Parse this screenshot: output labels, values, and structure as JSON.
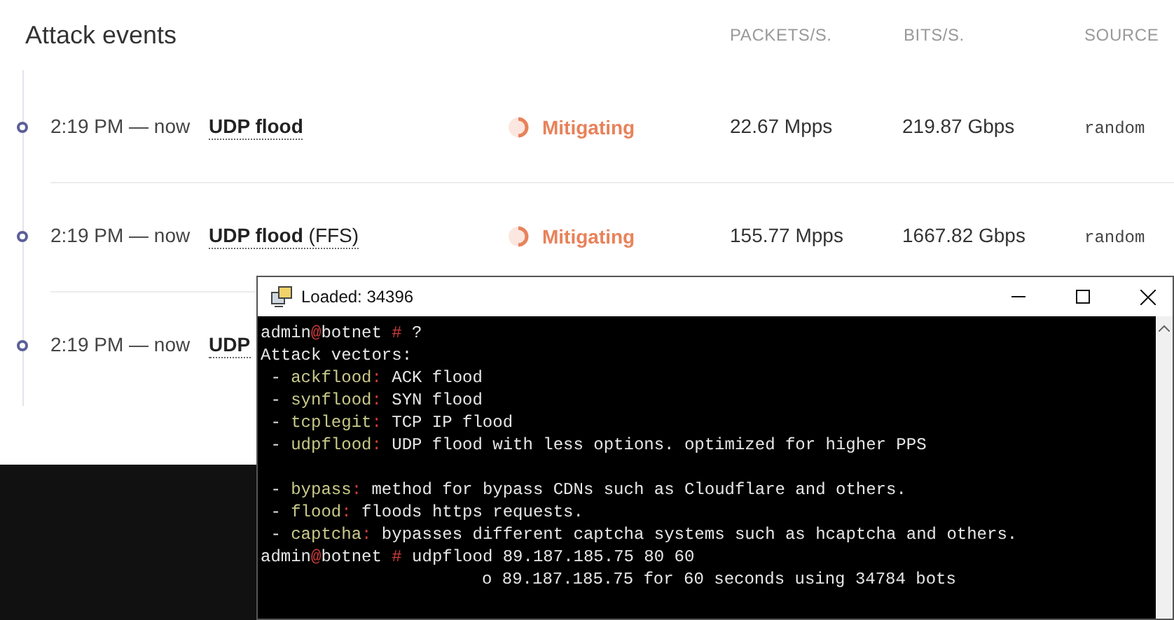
{
  "header": {
    "title": "Attack events",
    "columns": [
      "PACKETS/S.",
      "BITS/S.",
      "SOURCE"
    ]
  },
  "events": [
    {
      "time": "2:19 PM — now",
      "attack": "UDP flood",
      "status": "Mitigating",
      "packets": "22.67 Mpps",
      "bits": "219.87 Gbps",
      "source": "random"
    },
    {
      "time": "2:19 PM — now",
      "attack": "UDP flood",
      "suffix": "(FFS)",
      "status": "Mitigating",
      "packets": "155.77 Mpps",
      "bits": "1667.82 Gbps",
      "source": "random"
    },
    {
      "time": "2:19 PM — now",
      "attack": "UDP"
    }
  ],
  "terminal": {
    "title": "Loaded: 34396",
    "lines": [
      {
        "parts": [
          {
            "text": "admin"
          },
          {
            "text": "@",
            "kind": "accent"
          },
          {
            "text": "botnet "
          },
          {
            "text": "#",
            "kind": "accent"
          },
          {
            "text": " ?"
          }
        ]
      },
      {
        "parts": [
          {
            "text": "Attack vectors:"
          }
        ]
      },
      {
        "parts": [
          {
            "text": " - "
          },
          {
            "text": "ackflood",
            "kind": "keyword"
          },
          {
            "text": ":",
            "kind": "accent"
          },
          {
            "text": " ACK flood"
          }
        ]
      },
      {
        "parts": [
          {
            "text": " - "
          },
          {
            "text": "synflood",
            "kind": "keyword"
          },
          {
            "text": ":",
            "kind": "accent"
          },
          {
            "text": " SYN flood"
          }
        ]
      },
      {
        "parts": [
          {
            "text": " - "
          },
          {
            "text": "tcplegit",
            "kind": "keyword"
          },
          {
            "text": ":",
            "kind": "accent"
          },
          {
            "text": " TCP IP flood"
          }
        ]
      },
      {
        "parts": [
          {
            "text": " - "
          },
          {
            "text": "udpflood",
            "kind": "keyword"
          },
          {
            "text": ":",
            "kind": "accent"
          },
          {
            "text": " UDP flood with less options. optimized for higher PPS"
          }
        ]
      },
      {
        "kind": "blank"
      },
      {
        "parts": [
          {
            "text": " - "
          },
          {
            "text": "bypass",
            "kind": "keyword"
          },
          {
            "text": ":",
            "kind": "accent"
          },
          {
            "text": " method for bypass CDNs such as Cloudflare and others."
          }
        ]
      },
      {
        "parts": [
          {
            "text": " - "
          },
          {
            "text": "flood",
            "kind": "keyword"
          },
          {
            "text": ":",
            "kind": "accent"
          },
          {
            "text": " floods https requests."
          }
        ]
      },
      {
        "parts": [
          {
            "text": " - "
          },
          {
            "text": "captcha",
            "kind": "keyword"
          },
          {
            "text": ":",
            "kind": "accent"
          },
          {
            "text": " bypasses different captcha systems such as hcaptcha and others."
          }
        ]
      },
      {
        "parts": [
          {
            "text": "admin"
          },
          {
            "text": "@",
            "kind": "accent"
          },
          {
            "text": "botnet "
          },
          {
            "text": "#",
            "kind": "accent"
          },
          {
            "text": " udpflood 89.187.185.75 80 60"
          }
        ]
      },
      {
        "indented": true,
        "parts": [
          {
            "text": "o 89.187.185.75 for 60 seconds using 34784 bots"
          }
        ]
      }
    ]
  }
}
